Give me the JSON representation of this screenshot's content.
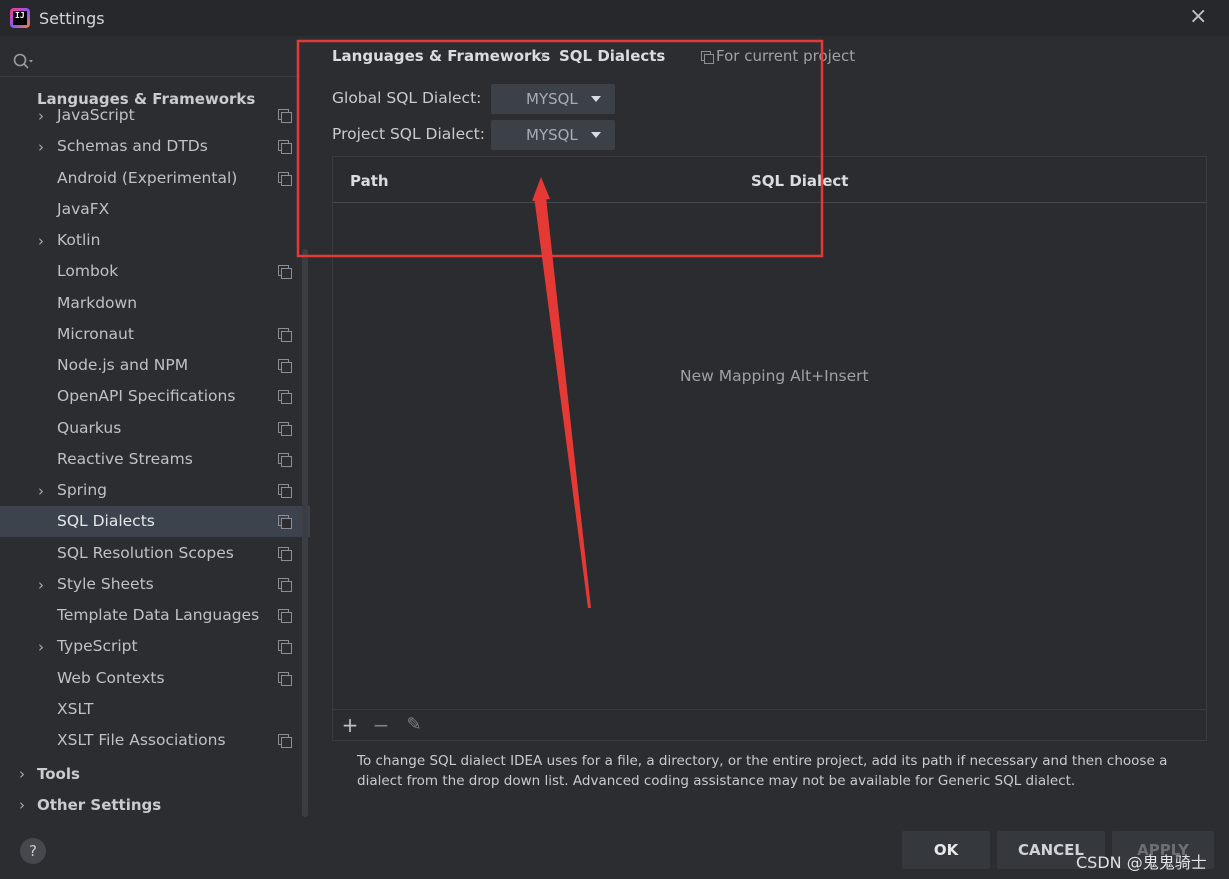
{
  "window": {
    "title": "Settings",
    "close_glyph": "×"
  },
  "sidebar": {
    "search_placeholder": "",
    "group_header": "Languages & Frameworks",
    "items": [
      {
        "label": "JavaScript",
        "expandable": true,
        "copy": true
      },
      {
        "label": "Schemas and DTDs",
        "expandable": true,
        "copy": true
      },
      {
        "label": "Android (Experimental)",
        "expandable": false,
        "copy": true
      },
      {
        "label": "JavaFX",
        "expandable": false,
        "copy": false
      },
      {
        "label": "Kotlin",
        "expandable": true,
        "copy": false
      },
      {
        "label": "Lombok",
        "expandable": false,
        "copy": true
      },
      {
        "label": "Markdown",
        "expandable": false,
        "copy": false
      },
      {
        "label": "Micronaut",
        "expandable": false,
        "copy": true
      },
      {
        "label": "Node.js and NPM",
        "expandable": false,
        "copy": true
      },
      {
        "label": "OpenAPI Specifications",
        "expandable": false,
        "copy": true
      },
      {
        "label": "Quarkus",
        "expandable": false,
        "copy": true
      },
      {
        "label": "Reactive Streams",
        "expandable": false,
        "copy": true
      },
      {
        "label": "Spring",
        "expandable": true,
        "copy": true
      },
      {
        "label": "SQL Dialects",
        "expandable": false,
        "copy": true,
        "selected": true
      },
      {
        "label": "SQL Resolution Scopes",
        "expandable": false,
        "copy": true
      },
      {
        "label": "Style Sheets",
        "expandable": true,
        "copy": true
      },
      {
        "label": "Template Data Languages",
        "expandable": false,
        "copy": true
      },
      {
        "label": "TypeScript",
        "expandable": true,
        "copy": true
      },
      {
        "label": "Web Contexts",
        "expandable": false,
        "copy": true
      },
      {
        "label": "XSLT",
        "expandable": false,
        "copy": false
      },
      {
        "label": "XSLT File Associations",
        "expandable": false,
        "copy": true
      }
    ],
    "bottom_groups": [
      "Tools",
      "Other Settings"
    ],
    "help_label": "?"
  },
  "breadcrumb": {
    "parent": "Languages & Frameworks",
    "separator": "›",
    "current": "SQL Dialects",
    "scope": "For current project"
  },
  "dialects": {
    "global_label": "Global SQL Dialect:",
    "global_value": "MYSQL",
    "project_label": "Project SQL Dialect:",
    "project_value": "MYSQL"
  },
  "table": {
    "columns": [
      "Path",
      "SQL Dialect"
    ],
    "empty_text": "New Mapping Alt+Insert",
    "toolbar": {
      "add": "+",
      "remove": "−",
      "edit": "✎"
    }
  },
  "hint": "To change SQL dialect IDEA uses for a file, a directory, or the entire project, add its path if necessary and then choose a dialect from the drop down list. Advanced coding assistance may not be available for Generic SQL dialect.",
  "buttons": {
    "ok": "OK",
    "cancel": "CANCEL",
    "apply": "APPLY"
  },
  "watermark": "CSDN @鬼鬼骑士",
  "colors": {
    "annotation": "#e53935",
    "background": "#2b2d30",
    "selection": "#3d434d"
  }
}
